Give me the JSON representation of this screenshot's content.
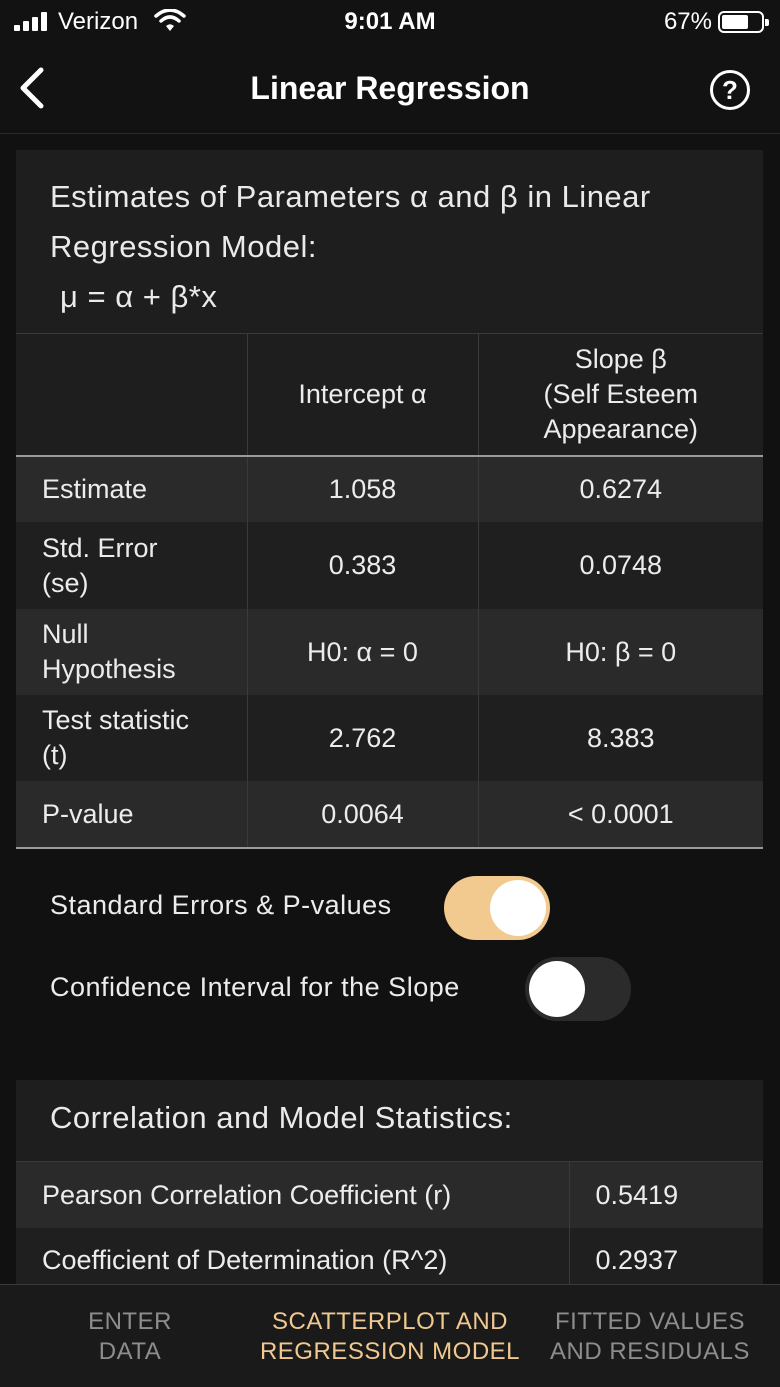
{
  "status_bar": {
    "carrier": "Verizon",
    "time": "9:01 AM",
    "battery": "67%"
  },
  "nav": {
    "title": "Linear Regression",
    "help_label": "?"
  },
  "estimates": {
    "title_line1": "Estimates of Parameters α and β in Linear",
    "title_line2": "Regression Model:",
    "formula": "μ = α + β*x",
    "headers": [
      "",
      "Intercept α",
      "Slope β",
      "(Self Esteem",
      "Appearance)"
    ],
    "rows": [
      {
        "label": "Estimate",
        "intercept": "1.058",
        "slope": "0.6274"
      },
      {
        "label": "Std. Error",
        "label2": "(se)",
        "intercept": "0.383",
        "slope": "0.0748"
      },
      {
        "label": "Null",
        "label2": "Hypothesis",
        "intercept": "H0: α = 0",
        "slope": "H0: β = 0"
      },
      {
        "label": "Test statistic",
        "label2": "(t)",
        "intercept": "2.762",
        "slope": "8.383"
      },
      {
        "label": "P-value",
        "intercept": "0.0064",
        "slope": "< 0.0001"
      }
    ]
  },
  "toggles": [
    {
      "label": "Standard Errors & P-values",
      "on": true
    },
    {
      "label": "Confidence Interval for the Slope",
      "on": false
    }
  ],
  "correlation": {
    "title": "Correlation and Model Statistics:",
    "rows": [
      {
        "label": "Pearson Correlation Coefficient (r)",
        "value": "0.5419"
      },
      {
        "label": "Coefficient of Determination (R^2)",
        "value": "0.2937"
      }
    ]
  },
  "tabs": [
    {
      "line1": "ENTER",
      "line2": "DATA",
      "active": false
    },
    {
      "line1": "SCATTERPLOT AND",
      "line2": "REGRESSION MODEL",
      "active": true
    },
    {
      "line1": "FITTED VALUES",
      "line2": "AND RESIDUALS",
      "active": false
    }
  ],
  "colors": {
    "accent": "#f0c890",
    "toggle_on_track": "#f2c98f",
    "toggle_off_track": "#2b2b2b",
    "background": "#111111",
    "card": "#1e1e1e"
  }
}
